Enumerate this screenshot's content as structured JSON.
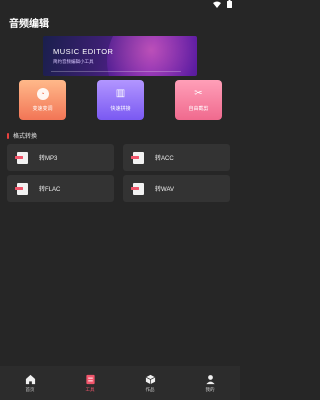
{
  "status": {
    "icons": [
      "wifi-icon",
      "battery-icon"
    ]
  },
  "app": {
    "title": "音频编辑"
  },
  "banner": {
    "title": "MUSIC EDITOR",
    "subtitle": "简约音频编辑小工具"
  },
  "features": [
    {
      "label": "变速变调",
      "icon": "speed-dial-icon",
      "color": "#f27556"
    },
    {
      "label": "快速拼接",
      "icon": "splice-icon",
      "color": "#7a59f2"
    },
    {
      "label": "自由截剪",
      "icon": "cut-icon",
      "color": "#f06a8e"
    }
  ],
  "section": {
    "title": "格式转换",
    "accent": "#e8423f"
  },
  "conversions": [
    {
      "label": "转MP3"
    },
    {
      "label": "转ACC"
    },
    {
      "label": "转FLAC"
    },
    {
      "label": "转WAV"
    }
  ],
  "nav": {
    "items": [
      {
        "label": "首页",
        "icon": "home-icon"
      },
      {
        "label": "工具",
        "icon": "tools-icon",
        "active": true
      },
      {
        "label": "作品",
        "icon": "works-icon"
      },
      {
        "label": "我的",
        "icon": "profile-icon"
      }
    ],
    "active_color": "#f1556b"
  }
}
